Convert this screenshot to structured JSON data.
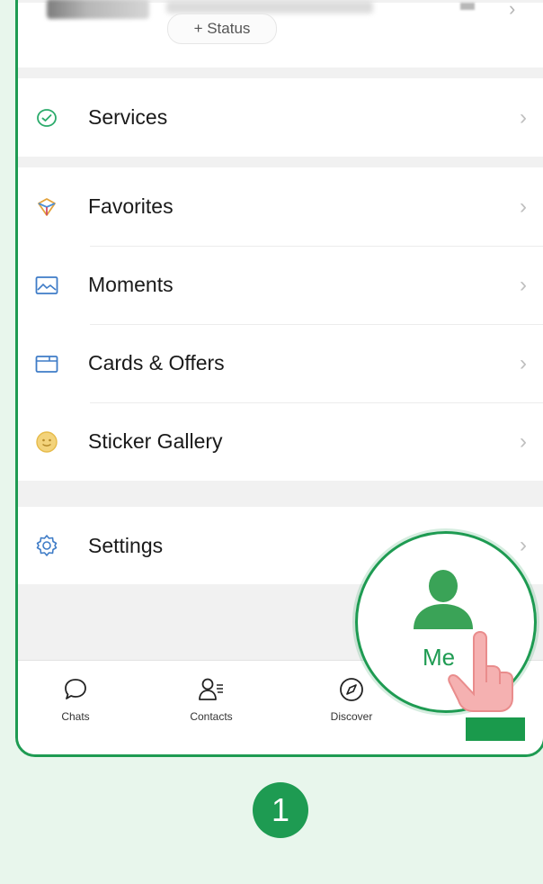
{
  "profile": {
    "status_button": "+ Status"
  },
  "menu_groups": [
    {
      "items": [
        {
          "label": "Services",
          "icon": "services-icon"
        }
      ]
    },
    {
      "items": [
        {
          "label": "Favorites",
          "icon": "favorites-icon"
        },
        {
          "label": "Moments",
          "icon": "moments-icon"
        },
        {
          "label": "Cards & Offers",
          "icon": "cards-icon"
        },
        {
          "label": "Sticker Gallery",
          "icon": "sticker-icon"
        }
      ]
    },
    {
      "items": [
        {
          "label": "Settings",
          "icon": "settings-icon"
        }
      ]
    }
  ],
  "tabbar": {
    "tabs": [
      {
        "label": "Chats",
        "icon": "chat-bubble-icon"
      },
      {
        "label": "Contacts",
        "icon": "contacts-icon"
      },
      {
        "label": "Discover",
        "icon": "compass-icon"
      },
      {
        "label": "Me",
        "icon": "person-icon",
        "highlighted": true
      }
    ]
  },
  "step_badge": "1",
  "colors": {
    "accent": "#1e9b52",
    "background": "#e8f6ec"
  }
}
